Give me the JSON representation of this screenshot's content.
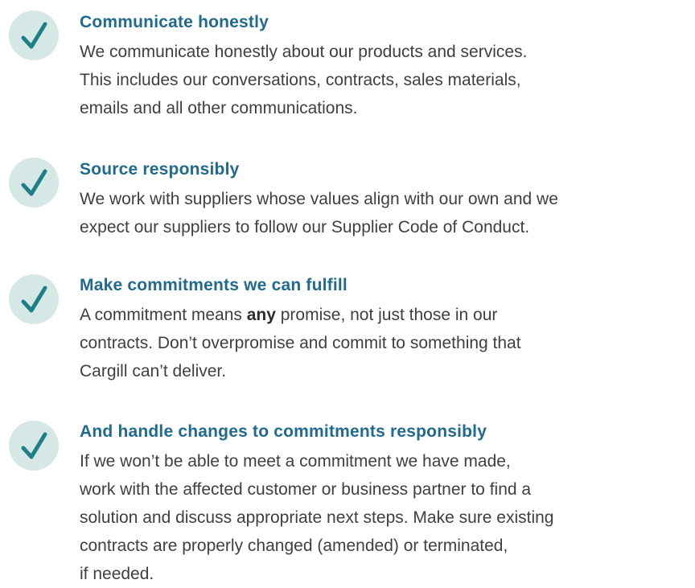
{
  "items": [
    {
      "title": "Communicate honestly",
      "lines": [
        "We communicate honestly about our products and services.",
        "This includes our conversations, contracts, sales materials,",
        "emails and all other communications."
      ]
    },
    {
      "title": "Source responsibly",
      "lines": [
        "We work with suppliers whose values align with our own and we",
        "expect our suppliers to follow our Supplier Code of Conduct."
      ]
    },
    {
      "title": "Make commitments we can fulfill",
      "line1_before": "A commitment means ",
      "line1_bold": "any",
      "line1_after": " promise, not just those in our",
      "lines": [
        "contracts. Don’t overpromise and commit to something that",
        "Cargill can’t deliver."
      ]
    },
    {
      "title": "And handle changes to commitments responsibly",
      "lines": [
        "If we won’t be able to meet a commitment we have made,",
        "work with the affected customer or business partner to find a",
        "solution and discuss appropriate next steps. Make sure existing",
        "contracts are properly changed (amended) or terminated,",
        "if needed."
      ]
    }
  ],
  "icon": "checkmark-icon",
  "colors": {
    "title": "#1f6a8e",
    "body": "#3f3f3f",
    "check_circle": "#d5e8e5",
    "check_mark": "#1e7f86"
  }
}
